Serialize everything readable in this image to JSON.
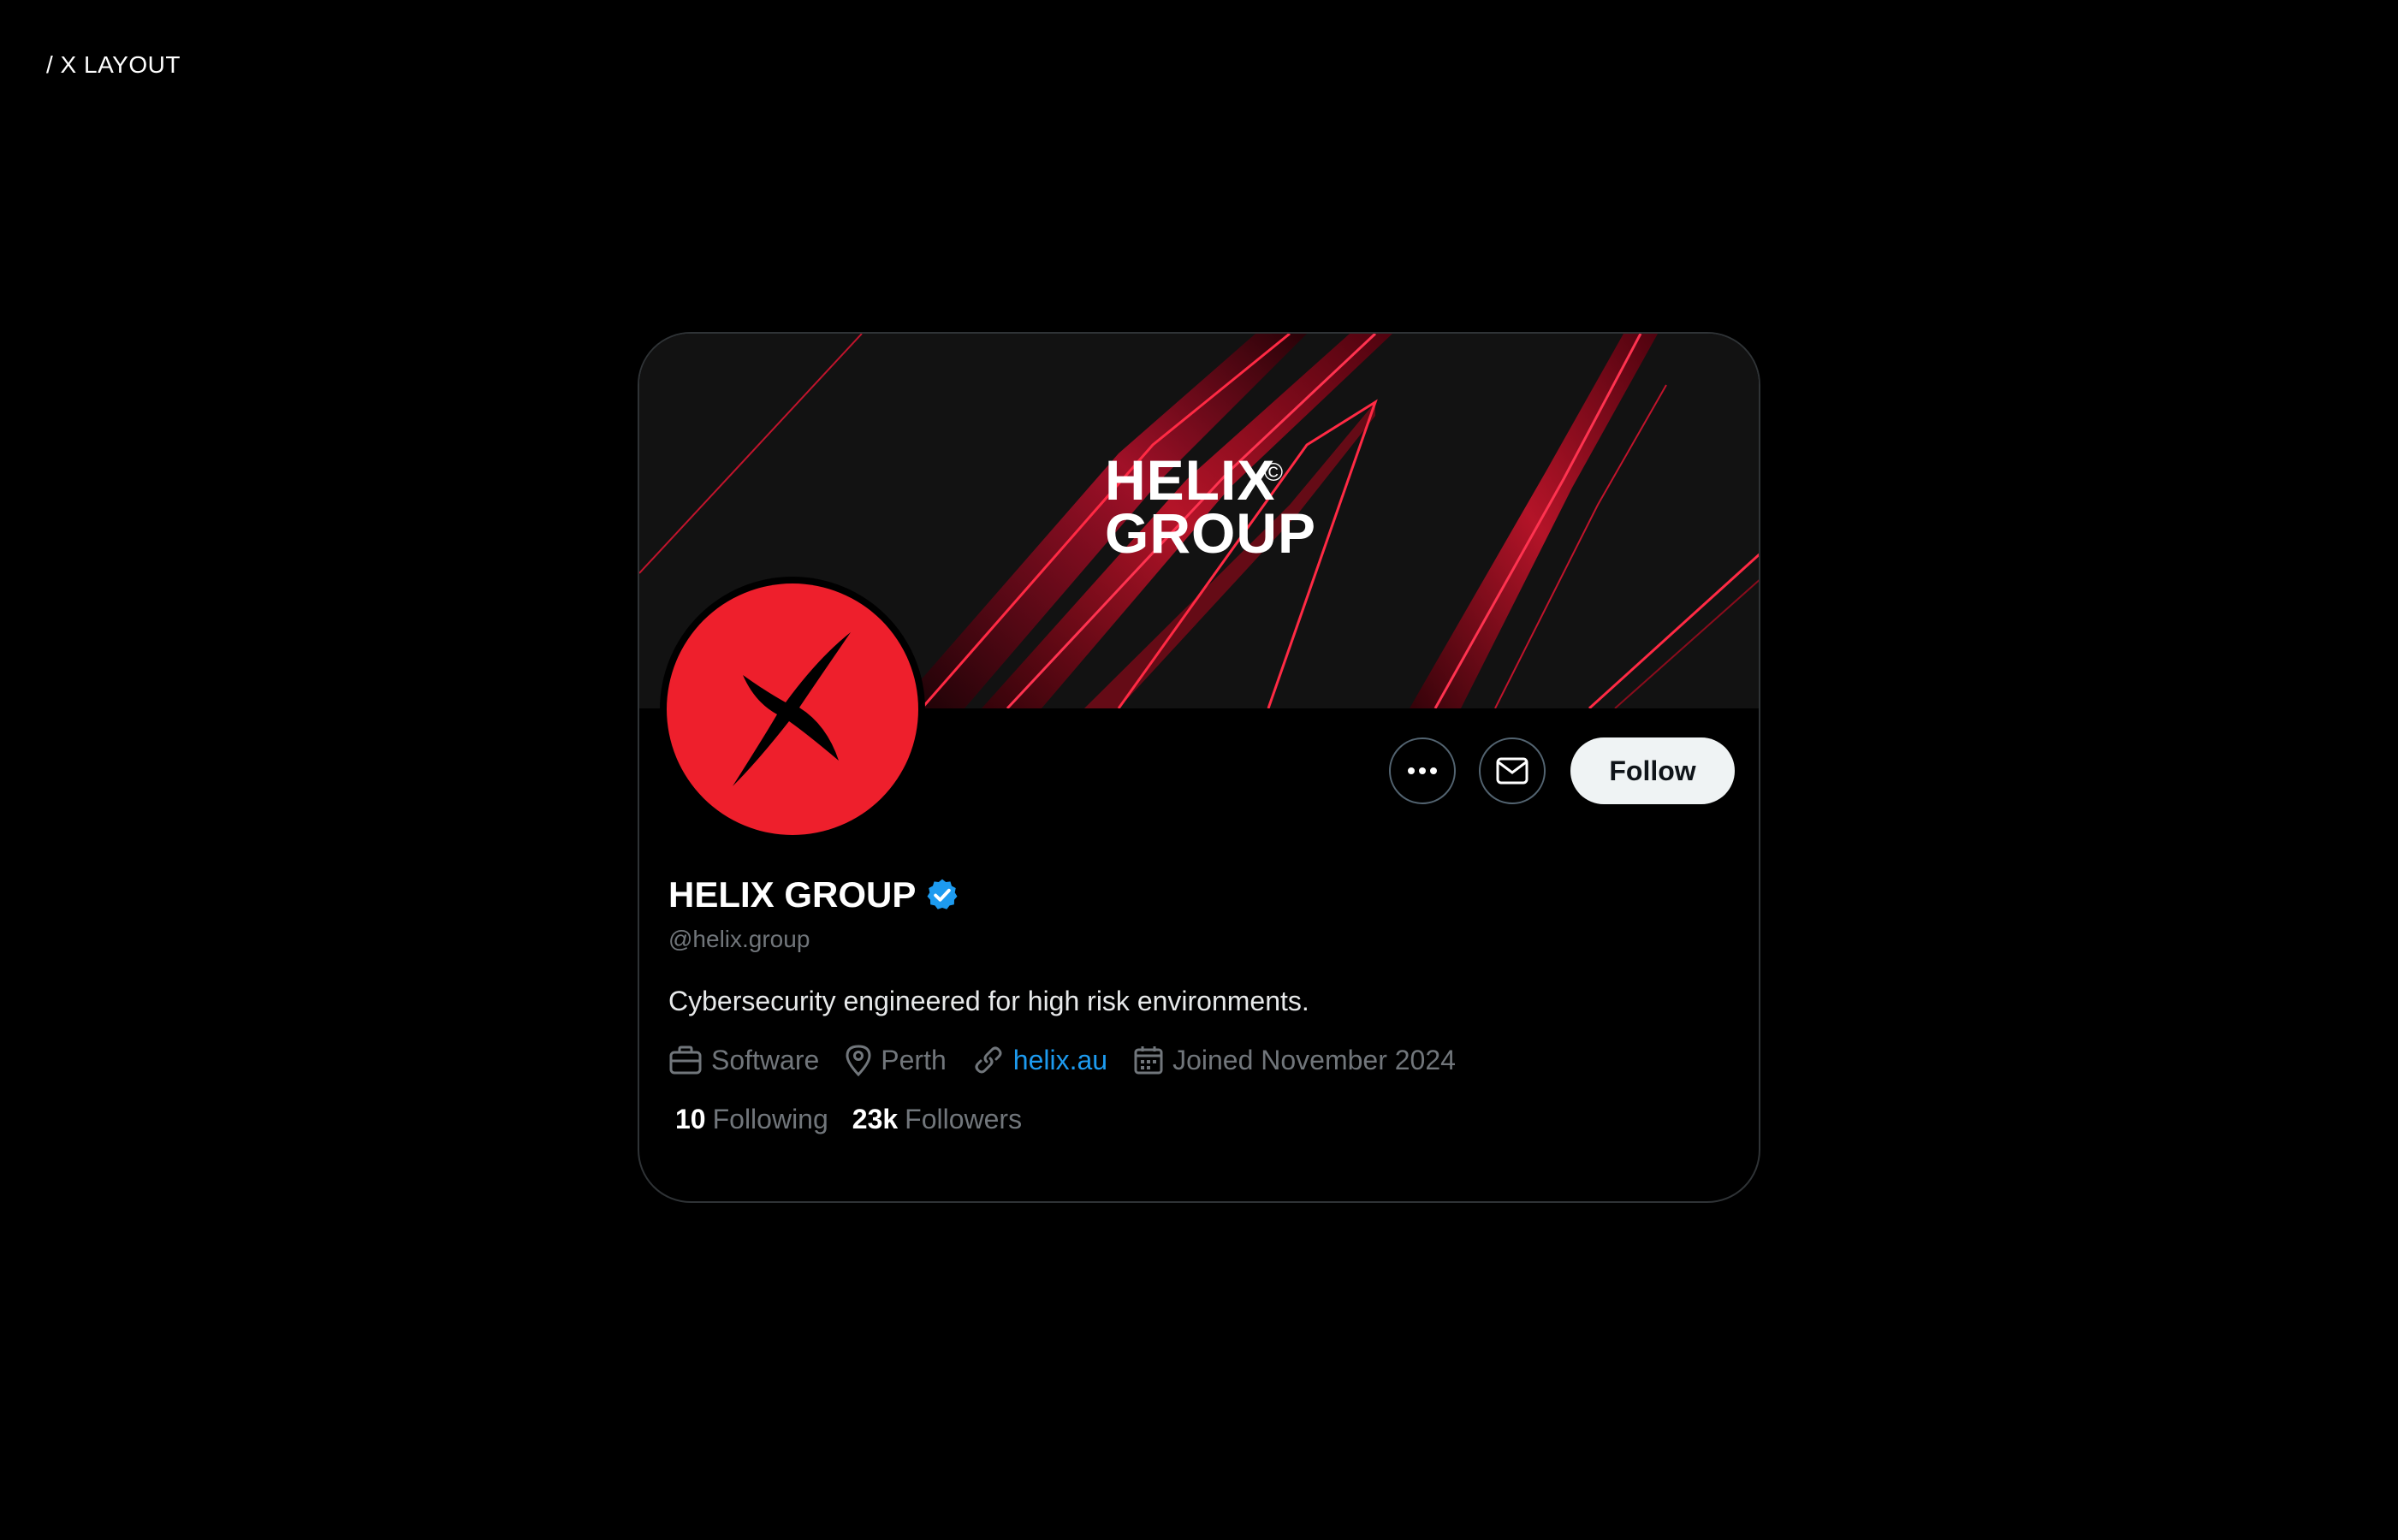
{
  "page": {
    "corner_label": "/ X LAYOUT"
  },
  "banner": {
    "logo_line1": "HELIX",
    "logo_line2": "GROUP",
    "logo_mark": "©"
  },
  "profile": {
    "display_name": "HELIX GROUP",
    "verified": true,
    "handle": "@helix.group",
    "bio": "Cybersecurity engineered for high risk environments.",
    "category": "Software",
    "location": "Perth",
    "website": "helix.au",
    "joined": "Joined November 2024",
    "following_count": "10",
    "following_label": "Following",
    "followers_count": "23k",
    "followers_label": "Followers"
  },
  "actions": {
    "more_icon": "more-horizontal-icon",
    "message_icon": "envelope-icon",
    "follow_label": "Follow"
  },
  "colors": {
    "background": "#000000",
    "brand_red": "#ee1f2c",
    "link_blue": "#1d9bf0",
    "verified_blue": "#1d9bf0",
    "muted_text": "#71767b",
    "follow_button_bg": "#eff3f4"
  }
}
